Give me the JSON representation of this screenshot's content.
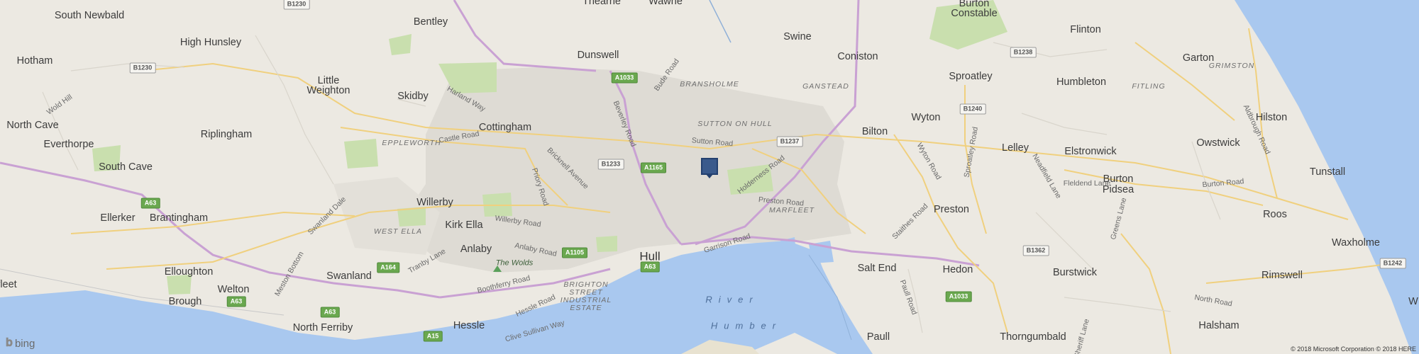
{
  "map": {
    "places": [
      {
        "id": "south-newbald",
        "name": "South Newbald"
      },
      {
        "id": "bentley",
        "name": "Bentley"
      },
      {
        "id": "thearne",
        "name": "Thearne"
      },
      {
        "id": "wawne",
        "name": "Wawne"
      },
      {
        "id": "high-hunsley",
        "name": "High Hunsley"
      },
      {
        "id": "hotham",
        "name": "Hotham"
      },
      {
        "id": "little-weighton-1",
        "name": "Little"
      },
      {
        "id": "little-weighton-2",
        "name": "Weighton"
      },
      {
        "id": "skidby",
        "name": "Skidby"
      },
      {
        "id": "dunswell",
        "name": "Dunswell"
      },
      {
        "id": "swine",
        "name": "Swine"
      },
      {
        "id": "coniston",
        "name": "Coniston"
      },
      {
        "id": "burton-constable-1",
        "name": "Burton"
      },
      {
        "id": "burton-constable-2",
        "name": "Constable"
      },
      {
        "id": "flinton",
        "name": "Flinton"
      },
      {
        "id": "garton",
        "name": "Garton"
      },
      {
        "id": "sproatley",
        "name": "Sproatley"
      },
      {
        "id": "humbleton",
        "name": "Humbleton"
      },
      {
        "id": "north-cave",
        "name": "North Cave"
      },
      {
        "id": "riplingham",
        "name": "Riplingham"
      },
      {
        "id": "cottingham",
        "name": "Cottingham"
      },
      {
        "id": "wyton",
        "name": "Wyton"
      },
      {
        "id": "bilton",
        "name": "Bilton"
      },
      {
        "id": "hilston",
        "name": "Hilston"
      },
      {
        "id": "everthorpe",
        "name": "Everthorpe"
      },
      {
        "id": "owstwick",
        "name": "Owstwick"
      },
      {
        "id": "lelley",
        "name": "Lelley"
      },
      {
        "id": "elstronwick",
        "name": "Elstronwick"
      },
      {
        "id": "south-cave",
        "name": "South Cave"
      },
      {
        "id": "tunstall",
        "name": "Tunstall"
      },
      {
        "id": "burton-pidsea-1",
        "name": "Burton"
      },
      {
        "id": "burton-pidsea-2",
        "name": "Pidsea"
      },
      {
        "id": "willerby",
        "name": "Willerby"
      },
      {
        "id": "ellerker",
        "name": "Ellerker"
      },
      {
        "id": "brantingham",
        "name": "Brantingham"
      },
      {
        "id": "kirk-ella",
        "name": "Kirk Ella"
      },
      {
        "id": "preston",
        "name": "Preston"
      },
      {
        "id": "roos",
        "name": "Roos"
      },
      {
        "id": "anlaby",
        "name": "Anlaby"
      },
      {
        "id": "waxholme",
        "name": "Waxholme"
      },
      {
        "id": "hull",
        "name": "Hull"
      },
      {
        "id": "salt-end",
        "name": "Salt End"
      },
      {
        "id": "hedon",
        "name": "Hedon"
      },
      {
        "id": "elloughton",
        "name": "Elloughton"
      },
      {
        "id": "swanland",
        "name": "Swanland"
      },
      {
        "id": "burstwick",
        "name": "Burstwick"
      },
      {
        "id": "rimswell",
        "name": "Rimswell"
      },
      {
        "id": "fleet",
        "name": "fleet"
      },
      {
        "id": "welton",
        "name": "Welton"
      },
      {
        "id": "brough",
        "name": "Brough"
      },
      {
        "id": "north-ferriby",
        "name": "North Ferriby"
      },
      {
        "id": "hessle",
        "name": "Hessle"
      },
      {
        "id": "halsham",
        "name": "Halsham"
      },
      {
        "id": "paull",
        "name": "Paull"
      },
      {
        "id": "thorngumbald",
        "name": "Thorngumbald"
      },
      {
        "id": "w-edge",
        "name": "W"
      }
    ],
    "districts": [
      {
        "id": "bransholme",
        "name": "BRANSHOLME"
      },
      {
        "id": "ganstead",
        "name": "GANSTEAD"
      },
      {
        "id": "grimston",
        "name": "GRIMSTON"
      },
      {
        "id": "fitling",
        "name": "FITLING"
      },
      {
        "id": "sutton-on-hull",
        "name": "SUTTON ON HULL"
      },
      {
        "id": "eppleworth",
        "name": "EPPLEWORTH"
      },
      {
        "id": "west-ella",
        "name": "WEST ELLA"
      },
      {
        "id": "marfleet",
        "name": "MARFLEET"
      },
      {
        "id": "brighton-1",
        "name": "BRIGHTON"
      },
      {
        "id": "brighton-2",
        "name": "STREET"
      },
      {
        "id": "brighton-3",
        "name": "INDUSTRIAL"
      },
      {
        "id": "brighton-4",
        "name": "ESTATE"
      }
    ],
    "roads": [
      {
        "id": "wold-hill",
        "name": "Wold Hill"
      },
      {
        "id": "harland-way",
        "name": "Harland Way"
      },
      {
        "id": "bude-road",
        "name": "Bude Road"
      },
      {
        "id": "beverley-road",
        "name": "Beverley Road"
      },
      {
        "id": "castle-road",
        "name": "Castle Road"
      },
      {
        "id": "sutton-road",
        "name": "Sutton Road"
      },
      {
        "id": "bricknell-avenue",
        "name": "Bricknell Avenue"
      },
      {
        "id": "holderness-road",
        "name": "Holderness Road"
      },
      {
        "id": "priory-road",
        "name": "Priory Road"
      },
      {
        "id": "preston-road",
        "name": "Preston Road"
      },
      {
        "id": "wyton-road",
        "name": "Wyton Road"
      },
      {
        "id": "sproatley-road",
        "name": "Sproatley Road"
      },
      {
        "id": "neadfield-lane",
        "name": "Neadfield Lane"
      },
      {
        "id": "fleldend-lane",
        "name": "Fleldend Lane"
      },
      {
        "id": "burton-road",
        "name": "Burton Road"
      },
      {
        "id": "aldbrough-road",
        "name": "Aldbrough Road"
      },
      {
        "id": "swanland-dale",
        "name": "Swanland Dale"
      },
      {
        "id": "willerby-road",
        "name": "Willerby Road"
      },
      {
        "id": "staithes-road",
        "name": "Staithes Road"
      },
      {
        "id": "garrison-road",
        "name": "Garrison Road"
      },
      {
        "id": "anlaby-road",
        "name": "Anlaby Road"
      },
      {
        "id": "tranby-lane",
        "name": "Tranby Lane"
      },
      {
        "id": "greens-lane",
        "name": "Greens Lane"
      },
      {
        "id": "boothferry-road",
        "name": "Boothferry Road"
      },
      {
        "id": "hessle-road",
        "name": "Hessle Road"
      },
      {
        "id": "paull-road",
        "name": "Paull Road"
      },
      {
        "id": "north-road",
        "name": "North Road"
      },
      {
        "id": "clive-sullivan-way",
        "name": "Clive Sullivan Way"
      },
      {
        "id": "meston-bottom",
        "name": "Meston Bottom"
      },
      {
        "id": "sheriff-lane",
        "name": "Sheriff Lane"
      }
    ],
    "parks": [
      {
        "id": "the-wolds",
        "name": "The Wolds"
      }
    ],
    "water": [
      {
        "id": "river",
        "name": "River"
      },
      {
        "id": "humber",
        "name": "Humber"
      }
    ],
    "shields": [
      {
        "id": "b1230-a",
        "label": "B1230",
        "kind": "b"
      },
      {
        "id": "b1230-b",
        "label": "B1230",
        "kind": "b"
      },
      {
        "id": "a1033-north",
        "label": "A1033",
        "kind": "a"
      },
      {
        "id": "b1238",
        "label": "B1238",
        "kind": "b"
      },
      {
        "id": "b1240",
        "label": "B1240",
        "kind": "b"
      },
      {
        "id": "b1237",
        "label": "B1237",
        "kind": "b"
      },
      {
        "id": "b1233",
        "label": "B1233",
        "kind": "b"
      },
      {
        "id": "a1165",
        "label": "A1165",
        "kind": "a"
      },
      {
        "id": "a63-west",
        "label": "A63",
        "kind": "a"
      },
      {
        "id": "a1105",
        "label": "A1105",
        "kind": "a"
      },
      {
        "id": "a63-hull",
        "label": "A63",
        "kind": "a"
      },
      {
        "id": "b1362",
        "label": "B1362",
        "kind": "b"
      },
      {
        "id": "b1242",
        "label": "B1242",
        "kind": "b"
      },
      {
        "id": "a164",
        "label": "A164",
        "kind": "a"
      },
      {
        "id": "a63-welton",
        "label": "A63",
        "kind": "a"
      },
      {
        "id": "a63-ferriby",
        "label": "A63",
        "kind": "a"
      },
      {
        "id": "a1033-hedon",
        "label": "A1033",
        "kind": "a"
      },
      {
        "id": "a15",
        "label": "A15",
        "kind": "a"
      }
    ]
  },
  "attribution": {
    "brand": "bing",
    "brand_icon": "bing-logo-icon",
    "copyright": "© 2018 Microsoft Corporation © 2018 HERE"
  },
  "pin": {
    "icon": "location-pin-icon"
  },
  "colors": {
    "water": "#a9c8ef",
    "land": "#ece9e2",
    "green": "#c9dfae",
    "motorway": "#c9a1d3",
    "road": "#f0d07e",
    "urban": "#dedbd4",
    "pin": "#3a5a8c"
  }
}
